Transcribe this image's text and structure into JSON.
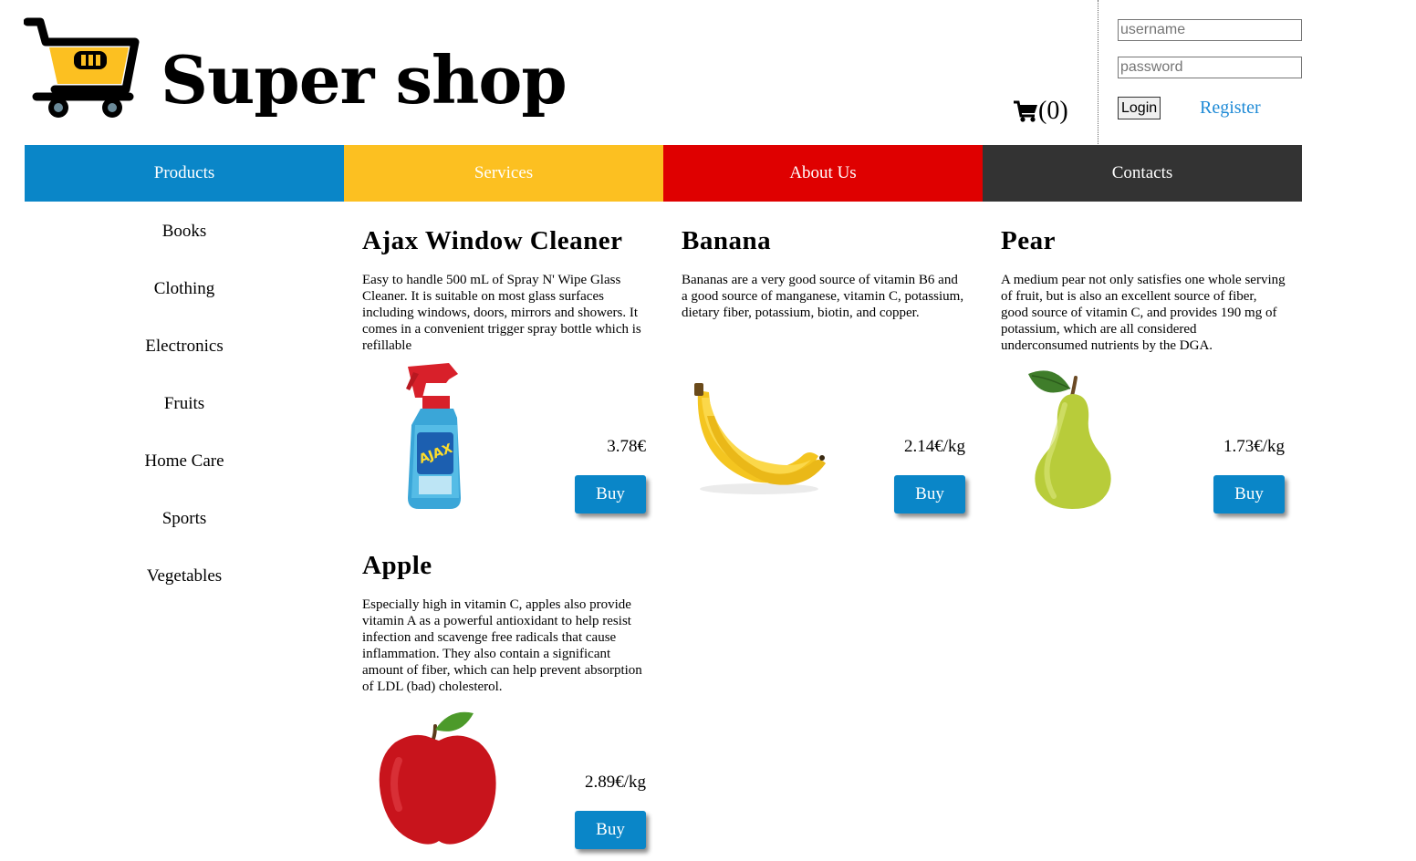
{
  "header": {
    "title": "Super shop",
    "cart_count": "(0)",
    "username_placeholder": "username",
    "password_placeholder": "password",
    "login_label": "Login",
    "register_label": "Register"
  },
  "nav": [
    {
      "label": "Products",
      "color": "#0a86c8"
    },
    {
      "label": "Services",
      "color": "#fcc021"
    },
    {
      "label": "About Us",
      "color": "#df0000"
    },
    {
      "label": "Contacts",
      "color": "#333333"
    }
  ],
  "categories": [
    "Books",
    "Clothing",
    "Electronics",
    "Fruits",
    "Home Care",
    "Sports",
    "Vegetables"
  ],
  "products": [
    {
      "title": "Ajax Window Cleaner",
      "description": "Easy to handle 500 mL of Spray N' Wipe Glass Cleaner. It is suitable on most glass surfaces including windows, doors, mirrors and showers. It comes in a convenient trigger spray bottle which is refillable",
      "price": "3.78€",
      "buy_label": "Buy",
      "image": "spray-bottle-image",
      "bottle_label": "AJAX"
    },
    {
      "title": "Banana",
      "description": "Bananas are a very good source of vitamin B6 and a good source of manganese, vitamin C, potassium, dietary fiber, potassium, biotin, and copper.",
      "price": "2.14€/kg",
      "buy_label": "Buy",
      "image": "banana-image"
    },
    {
      "title": "Pear",
      "description": "A medium pear not only satisfies one whole serving of fruit, but is also an excellent source of fiber, good source of vitamin C, and provides 190 mg of potassium, which are all considered underconsumed nutrients by the DGA.",
      "price": "1.73€/kg",
      "buy_label": "Buy",
      "image": "pear-image"
    },
    {
      "title": "Apple",
      "description": "Especially high in vitamin C, apples also provide vitamin A as a powerful antioxidant to help resist infection and scavenge free radicals that cause inflammation. They also contain a significant amount of fiber, which can help prevent absorption of LDL (bad) cholesterol.",
      "price": "2.89€/kg",
      "buy_label": "Buy",
      "image": "apple-image"
    }
  ]
}
